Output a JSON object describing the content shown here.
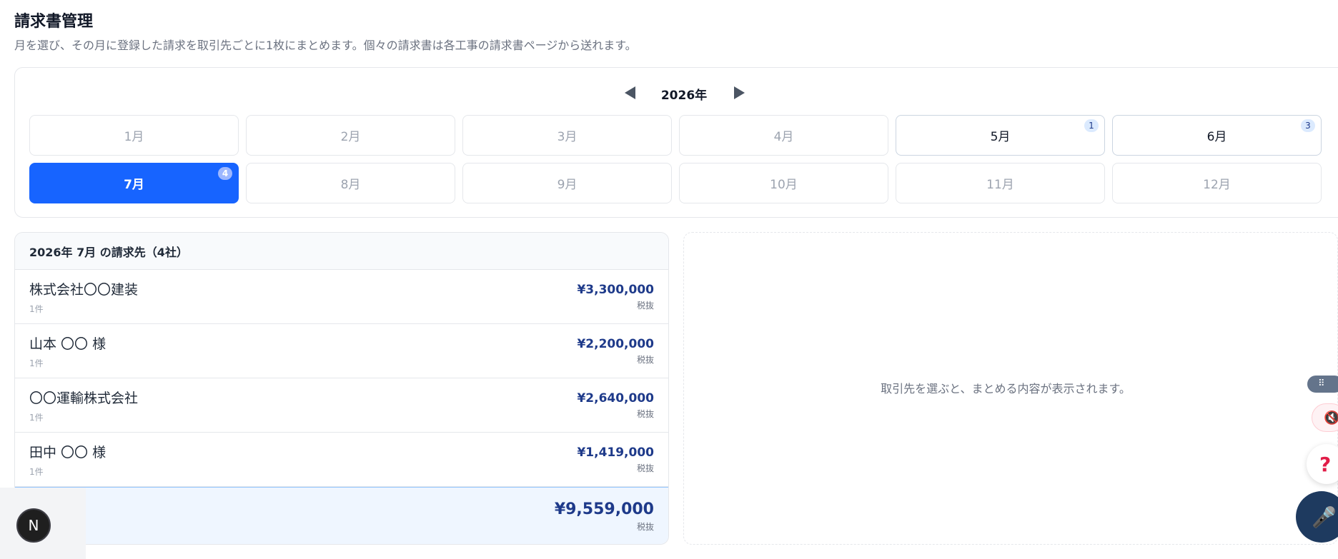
{
  "page": {
    "title": "請求書管理",
    "subtitle": "月を選び、その月に登録した請求を取引先ごとに1枚にまとめます。個々の請求書は各工事の請求書ページから送れます。"
  },
  "calendar": {
    "year_label": "2026年",
    "months": [
      {
        "label": "1月",
        "badge": null,
        "state": "empty"
      },
      {
        "label": "2月",
        "badge": null,
        "state": "empty"
      },
      {
        "label": "3月",
        "badge": null,
        "state": "empty"
      },
      {
        "label": "4月",
        "badge": null,
        "state": "empty"
      },
      {
        "label": "5月",
        "badge": "1",
        "state": "has"
      },
      {
        "label": "6月",
        "badge": "3",
        "state": "has"
      },
      {
        "label": "7月",
        "badge": "4",
        "state": "active"
      },
      {
        "label": "8月",
        "badge": null,
        "state": "empty"
      },
      {
        "label": "9月",
        "badge": null,
        "state": "empty"
      },
      {
        "label": "10月",
        "badge": null,
        "state": "empty"
      },
      {
        "label": "11月",
        "badge": null,
        "state": "empty"
      },
      {
        "label": "12月",
        "badge": null,
        "state": "empty"
      }
    ]
  },
  "list": {
    "header": "2026年 7月 の請求先（4社）",
    "clients": [
      {
        "name": "株式会社〇〇建装",
        "count": "1件",
        "amount": "¥3,300,000",
        "tax": "税抜"
      },
      {
        "name": "山本 〇〇 様",
        "count": "1件",
        "amount": "¥2,200,000",
        "tax": "税抜"
      },
      {
        "name": "〇〇運輸株式会社",
        "count": "1件",
        "amount": "¥2,640,000",
        "tax": "税抜"
      },
      {
        "name": "田中 〇〇 様",
        "count": "1件",
        "amount": "¥1,419,000",
        "tax": "税抜"
      }
    ],
    "total": {
      "label": ")",
      "amount": "¥9,559,000",
      "tax": "税抜"
    }
  },
  "detail": {
    "empty_message": "取引先を選ぶと、まとめる内容が表示されます。"
  },
  "floating": {
    "next_badge_letter": "N",
    "drag_handle_glyph": "⠿",
    "mute_icon": "🔇",
    "help_glyph": "?",
    "mic_icon": "🎤"
  },
  "colors": {
    "accent": "#1764ff",
    "amount": "#1e3a8a"
  }
}
